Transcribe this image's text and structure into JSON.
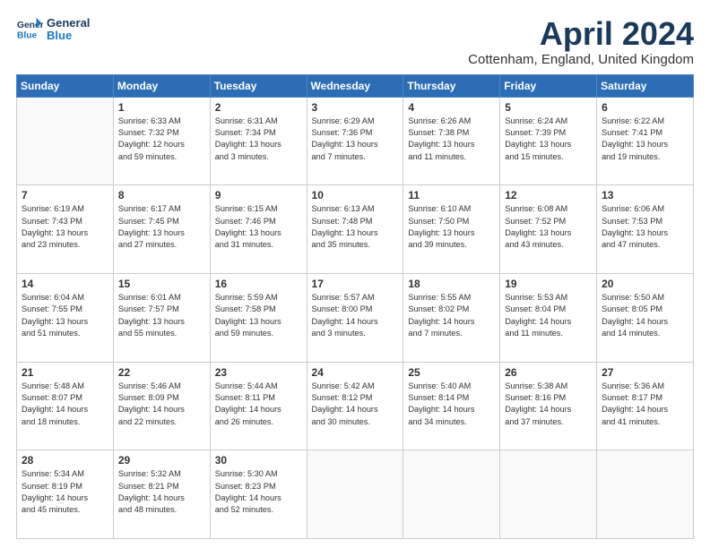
{
  "header": {
    "logo_line1": "General",
    "logo_line2": "Blue",
    "month_title": "April 2024",
    "location": "Cottenham, England, United Kingdom"
  },
  "weekdays": [
    "Sunday",
    "Monday",
    "Tuesday",
    "Wednesday",
    "Thursday",
    "Friday",
    "Saturday"
  ],
  "weeks": [
    [
      {
        "day": "",
        "info": ""
      },
      {
        "day": "1",
        "info": "Sunrise: 6:33 AM\nSunset: 7:32 PM\nDaylight: 12 hours\nand 59 minutes."
      },
      {
        "day": "2",
        "info": "Sunrise: 6:31 AM\nSunset: 7:34 PM\nDaylight: 13 hours\nand 3 minutes."
      },
      {
        "day": "3",
        "info": "Sunrise: 6:29 AM\nSunset: 7:36 PM\nDaylight: 13 hours\nand 7 minutes."
      },
      {
        "day": "4",
        "info": "Sunrise: 6:26 AM\nSunset: 7:38 PM\nDaylight: 13 hours\nand 11 minutes."
      },
      {
        "day": "5",
        "info": "Sunrise: 6:24 AM\nSunset: 7:39 PM\nDaylight: 13 hours\nand 15 minutes."
      },
      {
        "day": "6",
        "info": "Sunrise: 6:22 AM\nSunset: 7:41 PM\nDaylight: 13 hours\nand 19 minutes."
      }
    ],
    [
      {
        "day": "7",
        "info": "Sunrise: 6:19 AM\nSunset: 7:43 PM\nDaylight: 13 hours\nand 23 minutes."
      },
      {
        "day": "8",
        "info": "Sunrise: 6:17 AM\nSunset: 7:45 PM\nDaylight: 13 hours\nand 27 minutes."
      },
      {
        "day": "9",
        "info": "Sunrise: 6:15 AM\nSunset: 7:46 PM\nDaylight: 13 hours\nand 31 minutes."
      },
      {
        "day": "10",
        "info": "Sunrise: 6:13 AM\nSunset: 7:48 PM\nDaylight: 13 hours\nand 35 minutes."
      },
      {
        "day": "11",
        "info": "Sunrise: 6:10 AM\nSunset: 7:50 PM\nDaylight: 13 hours\nand 39 minutes."
      },
      {
        "day": "12",
        "info": "Sunrise: 6:08 AM\nSunset: 7:52 PM\nDaylight: 13 hours\nand 43 minutes."
      },
      {
        "day": "13",
        "info": "Sunrise: 6:06 AM\nSunset: 7:53 PM\nDaylight: 13 hours\nand 47 minutes."
      }
    ],
    [
      {
        "day": "14",
        "info": "Sunrise: 6:04 AM\nSunset: 7:55 PM\nDaylight: 13 hours\nand 51 minutes."
      },
      {
        "day": "15",
        "info": "Sunrise: 6:01 AM\nSunset: 7:57 PM\nDaylight: 13 hours\nand 55 minutes."
      },
      {
        "day": "16",
        "info": "Sunrise: 5:59 AM\nSunset: 7:58 PM\nDaylight: 13 hours\nand 59 minutes."
      },
      {
        "day": "17",
        "info": "Sunrise: 5:57 AM\nSunset: 8:00 PM\nDaylight: 14 hours\nand 3 minutes."
      },
      {
        "day": "18",
        "info": "Sunrise: 5:55 AM\nSunset: 8:02 PM\nDaylight: 14 hours\nand 7 minutes."
      },
      {
        "day": "19",
        "info": "Sunrise: 5:53 AM\nSunset: 8:04 PM\nDaylight: 14 hours\nand 11 minutes."
      },
      {
        "day": "20",
        "info": "Sunrise: 5:50 AM\nSunset: 8:05 PM\nDaylight: 14 hours\nand 14 minutes."
      }
    ],
    [
      {
        "day": "21",
        "info": "Sunrise: 5:48 AM\nSunset: 8:07 PM\nDaylight: 14 hours\nand 18 minutes."
      },
      {
        "day": "22",
        "info": "Sunrise: 5:46 AM\nSunset: 8:09 PM\nDaylight: 14 hours\nand 22 minutes."
      },
      {
        "day": "23",
        "info": "Sunrise: 5:44 AM\nSunset: 8:11 PM\nDaylight: 14 hours\nand 26 minutes."
      },
      {
        "day": "24",
        "info": "Sunrise: 5:42 AM\nSunset: 8:12 PM\nDaylight: 14 hours\nand 30 minutes."
      },
      {
        "day": "25",
        "info": "Sunrise: 5:40 AM\nSunset: 8:14 PM\nDaylight: 14 hours\nand 34 minutes."
      },
      {
        "day": "26",
        "info": "Sunrise: 5:38 AM\nSunset: 8:16 PM\nDaylight: 14 hours\nand 37 minutes."
      },
      {
        "day": "27",
        "info": "Sunrise: 5:36 AM\nSunset: 8:17 PM\nDaylight: 14 hours\nand 41 minutes."
      }
    ],
    [
      {
        "day": "28",
        "info": "Sunrise: 5:34 AM\nSunset: 8:19 PM\nDaylight: 14 hours\nand 45 minutes."
      },
      {
        "day": "29",
        "info": "Sunrise: 5:32 AM\nSunset: 8:21 PM\nDaylight: 14 hours\nand 48 minutes."
      },
      {
        "day": "30",
        "info": "Sunrise: 5:30 AM\nSunset: 8:23 PM\nDaylight: 14 hours\nand 52 minutes."
      },
      {
        "day": "",
        "info": ""
      },
      {
        "day": "",
        "info": ""
      },
      {
        "day": "",
        "info": ""
      },
      {
        "day": "",
        "info": ""
      }
    ]
  ]
}
